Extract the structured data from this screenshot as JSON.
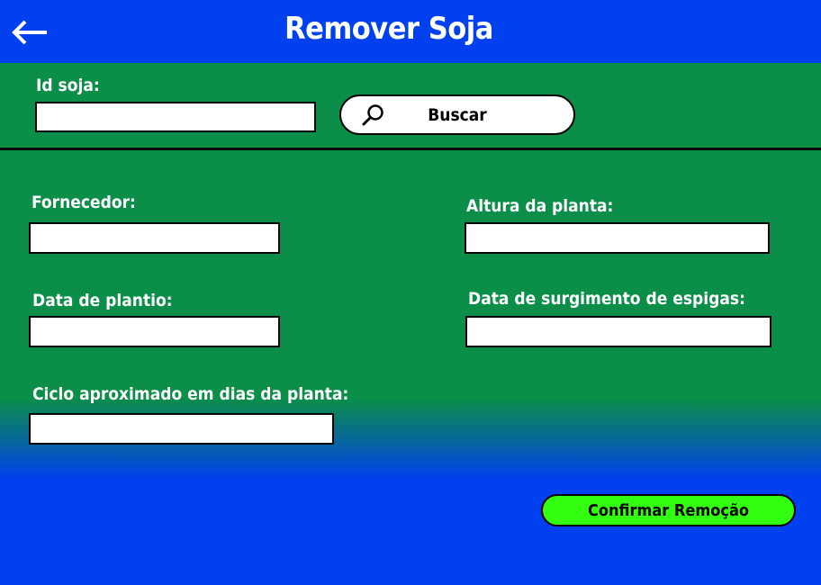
{
  "header": {
    "title": "Remover Soja",
    "back_icon": "arrow-left-icon"
  },
  "search": {
    "id_label": "Id soja:",
    "id_value": "",
    "button_label": "Buscar",
    "button_icon": "search-icon"
  },
  "form": {
    "fornecedor_label": "Fornecedor:",
    "fornecedor_value": "",
    "altura_label": "Altura da planta:",
    "altura_value": "",
    "data_plantio_label": "Data de plantio:",
    "data_plantio_value": "",
    "data_espigas_label": "Data de surgimento de espigas:",
    "data_espigas_value": "",
    "ciclo_label": "Ciclo aproximado em dias da planta:",
    "ciclo_value": ""
  },
  "actions": {
    "confirm_label": "Confirmar Remoção"
  },
  "colors": {
    "header_bg": "#0040ee",
    "form_bg": "#0a8e48",
    "confirm_bg": "#33ff11",
    "text": "#ffffff"
  }
}
